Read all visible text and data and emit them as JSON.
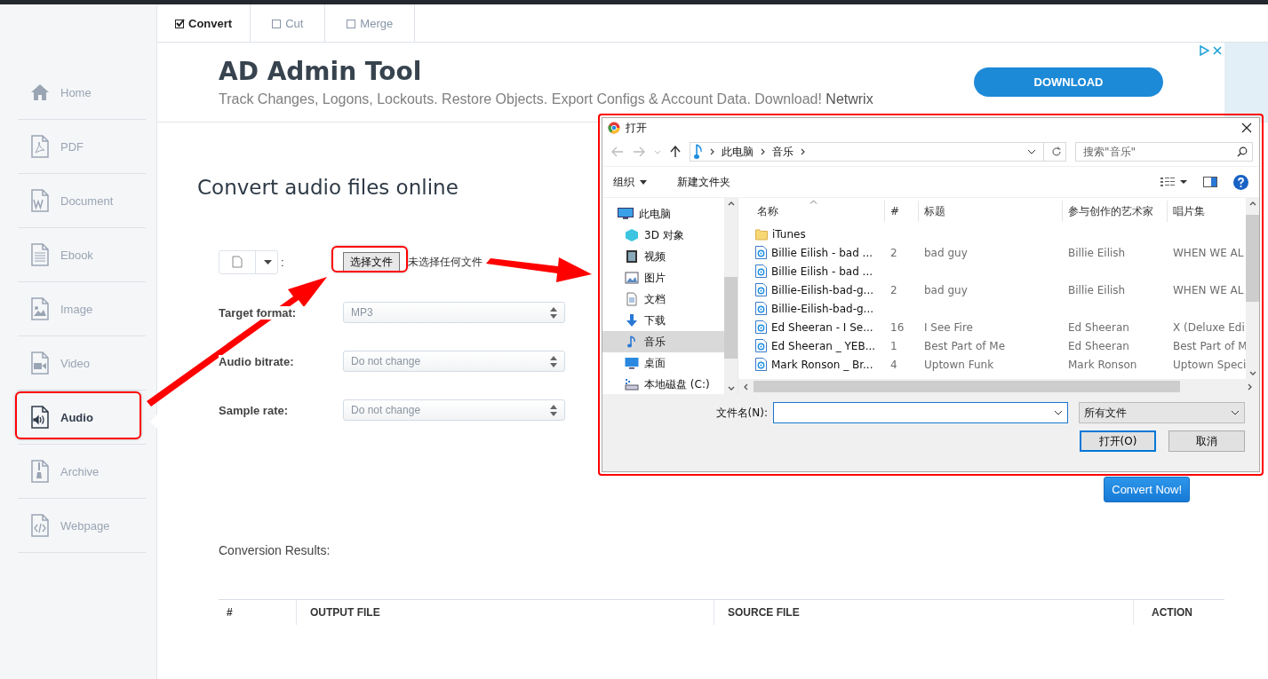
{
  "tabs": [
    {
      "label": "Convert",
      "selected": true
    },
    {
      "label": "Cut",
      "selected": false
    },
    {
      "label": "Merge",
      "selected": false
    }
  ],
  "sidebar": {
    "items": [
      {
        "label": "Home",
        "selected": false
      },
      {
        "label": "PDF",
        "selected": false
      },
      {
        "label": "Document",
        "selected": false
      },
      {
        "label": "Ebook",
        "selected": false
      },
      {
        "label": "Image",
        "selected": false
      },
      {
        "label": "Video",
        "selected": false
      },
      {
        "label": "Audio",
        "selected": true
      },
      {
        "label": "Archive",
        "selected": false
      },
      {
        "label": "Webpage",
        "selected": false
      }
    ]
  },
  "ad": {
    "title": "AD Admin Tool",
    "text": "Track Changes, Logons, Lockouts. Restore Objects. Export Configs & Account Data. Download!",
    "sponsor": "Netwrix",
    "button": "DOWNLOAD"
  },
  "heading": "Convert audio files online",
  "upload": {
    "separator": ":",
    "choose_button": "选择文件",
    "status": "未选择任何文件"
  },
  "options": [
    {
      "label": "Target format:",
      "value": "MP3"
    },
    {
      "label": "Audio bitrate:",
      "value": "Do not change"
    },
    {
      "label": "Sample rate:",
      "value": "Do not change"
    }
  ],
  "convert_button": "Convert Now!",
  "results": {
    "title": "Conversion Results:",
    "columns": [
      "#",
      "OUTPUT FILE",
      "SOURCE FILE",
      "ACTION"
    ]
  },
  "dialog": {
    "title": "打开",
    "path": [
      "此电脑",
      "音乐"
    ],
    "search_placeholder": "搜索\"音乐\"",
    "toolbar": [
      "组织",
      "新建文件夹"
    ],
    "tree": [
      {
        "label": "此电脑",
        "selected": false,
        "children": [
          {
            "label": "3D 对象",
            "selected": false
          },
          {
            "label": "视频",
            "selected": false
          },
          {
            "label": "图片",
            "selected": false
          },
          {
            "label": "文档",
            "selected": false
          },
          {
            "label": "下载",
            "selected": false
          },
          {
            "label": "音乐",
            "selected": true
          },
          {
            "label": "桌面",
            "selected": false
          },
          {
            "label": "本地磁盘 (C:)",
            "selected": false
          }
        ]
      }
    ],
    "columns": [
      "名称",
      "#",
      "标题",
      "参与创作的艺术家",
      "唱片集"
    ],
    "files": [
      {
        "kind": "folder",
        "name": "iTunes"
      },
      {
        "kind": "audio",
        "name": "Billie Eilish - bad ...",
        "number": "2",
        "title": "bad guy",
        "artist": "Billie Eilish",
        "album": "WHEN WE AL"
      },
      {
        "kind": "audio",
        "name": "Billie Eilish - bad ..."
      },
      {
        "kind": "audio",
        "name": "Billie-Eilish-bad-g...",
        "number": "2",
        "title": "bad guy",
        "artist": "Billie Eilish",
        "album": "WHEN WE AL"
      },
      {
        "kind": "audio",
        "name": "Billie-Eilish-bad-g..."
      },
      {
        "kind": "audio",
        "name": "Ed Sheeran - I Se...",
        "number": "16",
        "title": "I See Fire",
        "artist": "Ed Sheeran",
        "album": "X (Deluxe Edi"
      },
      {
        "kind": "audio",
        "name": "Ed Sheeran _ YEB...",
        "number": "1",
        "title": "Best Part of Me",
        "artist": "Ed Sheeran",
        "album": "Best Part of M"
      },
      {
        "kind": "audio",
        "name": "Mark Ronson _ Br...",
        "number": "4",
        "title": "Uptown Funk",
        "artist": "Mark Ronson",
        "album": "Uptown Speci"
      }
    ],
    "filename_label": "文件名(N):",
    "filetype": "所有文件",
    "buttons": [
      "打开(O)",
      "取消"
    ]
  }
}
